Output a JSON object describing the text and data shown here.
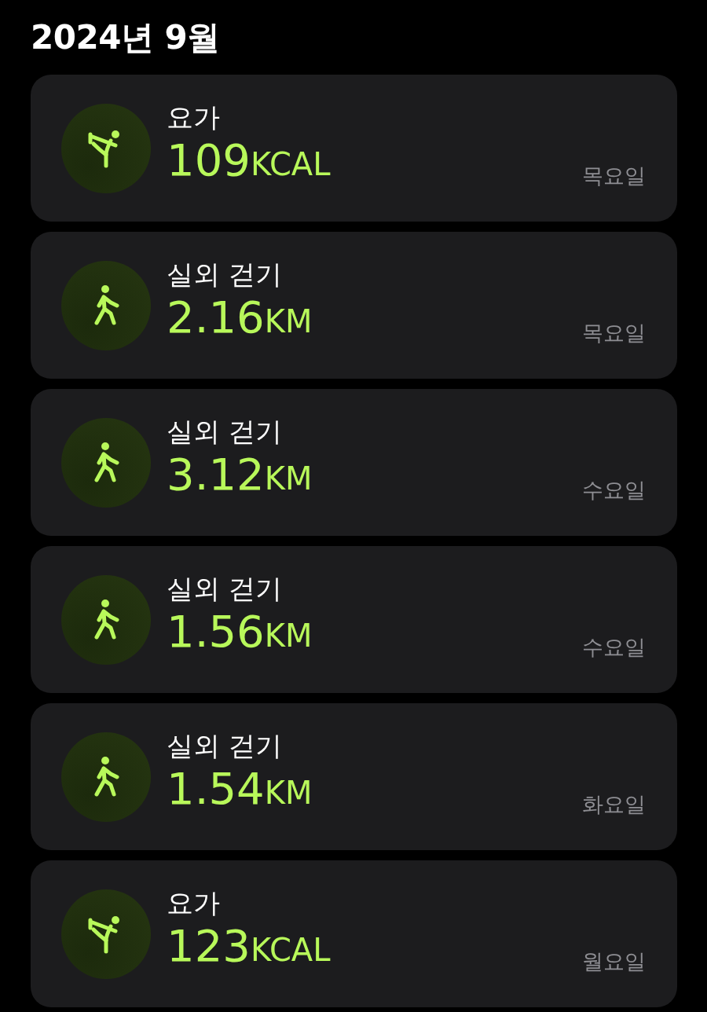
{
  "header": {
    "title": "2024년 9월"
  },
  "workouts": [
    {
      "kind": "yoga",
      "name": "요가",
      "value": "109",
      "unit": "KCAL",
      "day": "목요일"
    },
    {
      "kind": "walk",
      "name": "실외 걷기",
      "value": "2.16",
      "unit": "KM",
      "day": "목요일"
    },
    {
      "kind": "walk",
      "name": "실외 걷기",
      "value": "3.12",
      "unit": "KM",
      "day": "수요일"
    },
    {
      "kind": "walk",
      "name": "실외 걷기",
      "value": "1.56",
      "unit": "KM",
      "day": "수요일"
    },
    {
      "kind": "walk",
      "name": "실외 걷기",
      "value": "1.54",
      "unit": "KM",
      "day": "화요일"
    },
    {
      "kind": "yoga",
      "name": "요가",
      "value": "123",
      "unit": "KCAL",
      "day": "월요일"
    }
  ]
}
